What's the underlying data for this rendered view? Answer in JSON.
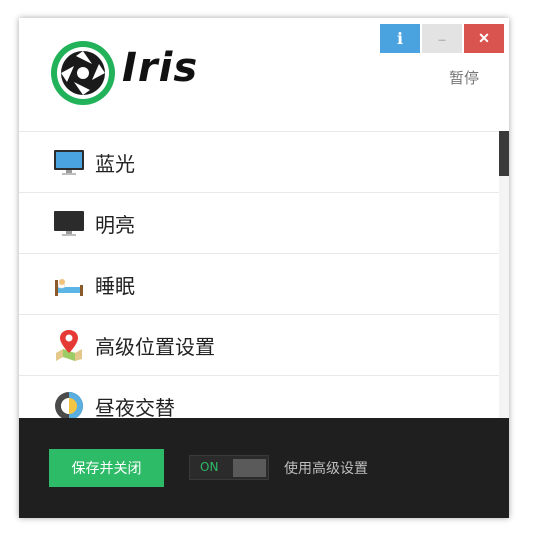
{
  "app": {
    "logo_text": "Iris",
    "pause_label": "暂停",
    "controls": {
      "info": "i",
      "minimize": "–",
      "close": "✕"
    },
    "accent_color": "#2dbb67",
    "info_color": "#4aa3df",
    "close_color": "#d9534f"
  },
  "menu": {
    "items": [
      {
        "label": "蓝光",
        "icon": "monitor-icon"
      },
      {
        "label": "明亮",
        "icon": "monitor-icon"
      },
      {
        "label": "睡眠",
        "icon": "bed-icon"
      },
      {
        "label": "高级位置设置",
        "icon": "map-pin-icon"
      },
      {
        "label": "昼夜交替",
        "icon": "day-night-icon"
      }
    ]
  },
  "footer": {
    "save_label": "保存并关闭",
    "toggle_label": "ON",
    "advanced_label": "使用高级设置"
  }
}
